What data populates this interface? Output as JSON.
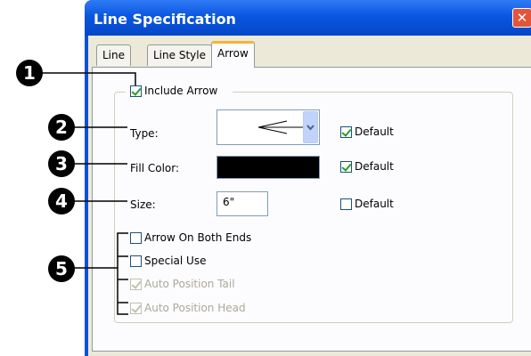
{
  "window": {
    "title": "Line Specification",
    "close_glyph": "✕"
  },
  "tabs": [
    {
      "label": "Line",
      "active": false
    },
    {
      "label": "Line Style",
      "active": false
    },
    {
      "label": "Arrow",
      "active": true
    }
  ],
  "group": {
    "include_arrow_label": "Include Arrow",
    "include_arrow_checked": true
  },
  "fields": {
    "type_label": "Type:",
    "fill_color_label": "Fill Color:",
    "fill_color_value": "#000000",
    "size_label": "Size:",
    "size_value": "6\""
  },
  "defaults": [
    {
      "label": "Default",
      "checked": true
    },
    {
      "label": "Default",
      "checked": true
    },
    {
      "label": "Default",
      "checked": false
    }
  ],
  "options": [
    {
      "label": "Arrow On Both Ends",
      "checked": false,
      "enabled": true
    },
    {
      "label": "Special Use",
      "checked": false,
      "enabled": true
    },
    {
      "label": "Auto Position Tail",
      "checked": true,
      "enabled": false
    },
    {
      "label": "Auto Position Head",
      "checked": true,
      "enabled": false
    }
  ],
  "callouts": [
    "1",
    "2",
    "3",
    "4",
    "5"
  ],
  "colors": {
    "title_bar": "#0a56e0",
    "close_button": "#e2553a",
    "active_tab_accent": "#f8b338",
    "check_mark": "#21a121"
  }
}
